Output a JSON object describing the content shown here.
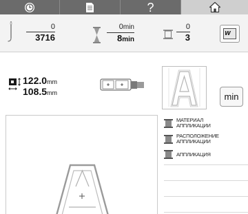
{
  "tabs": [
    {
      "icon": "clock-icon"
    },
    {
      "icon": "document-icon"
    },
    {
      "icon": "help-icon",
      "label": "?"
    },
    {
      "icon": "home-icon",
      "selected": true
    }
  ],
  "status": {
    "stitches": {
      "current": "0",
      "total": "3716"
    },
    "time": {
      "current": "0",
      "current_unit": "min",
      "total": "8",
      "total_unit": "min"
    },
    "colors": {
      "current": "0",
      "total": "3"
    },
    "hoop_button_label": "W"
  },
  "size": {
    "height": "122.0",
    "height_unit": "mm",
    "width": "108.5",
    "width_unit": "mm"
  },
  "min_button_label": "min",
  "threads": [
    {
      "line1": "МАТЕРИАЛ",
      "line2": "АППЛИКАЦИИ",
      "color": "#8a8a8a"
    },
    {
      "line1": "РАСПОЛОЖЕНИЕ",
      "line2": "АППЛИКАЦИИ",
      "color": "#8a8a8a"
    },
    {
      "line1": "АППЛИКАЦИЯ",
      "line2": "",
      "color": "#8a8a8a"
    }
  ],
  "preview_letter": "A"
}
